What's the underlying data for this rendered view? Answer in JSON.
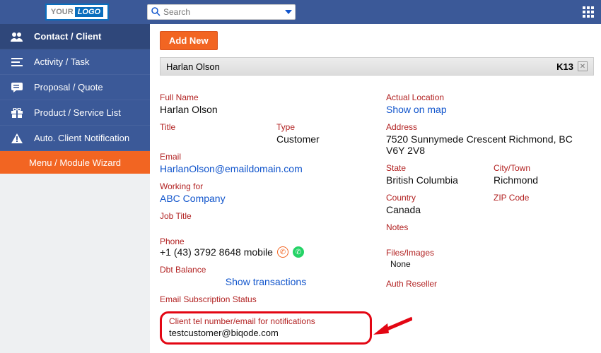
{
  "topbar": {
    "logo_your": "YOUR",
    "logo_logo": "LOGO",
    "search_placeholder": "Search"
  },
  "sidebar": {
    "items": [
      {
        "label": "Contact / Client"
      },
      {
        "label": "Activity / Task"
      },
      {
        "label": "Proposal / Quote"
      },
      {
        "label": "Product / Service List"
      },
      {
        "label": "Auto. Client Notification"
      }
    ],
    "wizard": "Menu / Module Wizard"
  },
  "main": {
    "add_new": "Add New",
    "record_name": "Harlan Olson",
    "record_code": "K13",
    "left": {
      "full_name_label": "Full Name",
      "full_name": "Harlan Olson",
      "title_label": "Title",
      "title": "",
      "type_label": "Type",
      "type": "Customer",
      "email_label": "Email",
      "email": "HarlanOlson@emaildomain.com",
      "working_for_label": "Working for",
      "working_for": "ABC Company",
      "job_title_label": "Job Title",
      "phone_label": "Phone",
      "phone": "+1 (43) 3792 8648 mobile",
      "dbt_label": "Dbt Balance",
      "show_txn": "Show transactions",
      "email_sub_label": "Email Subscription Status",
      "notif_label": "Client tel number/email for notifications",
      "notif_value": "testcustomer@biqode.com"
    },
    "right": {
      "actual_loc_label": "Actual Location",
      "show_on_map": "Show on map",
      "address_label": "Address",
      "address": "7520 Sunnymede Crescent Richmond, BC V6Y 2V8",
      "state_label": "State",
      "state": "British Columbia",
      "city_label": "City/Town",
      "city": "Richmond",
      "country_label": "Country",
      "country": "Canada",
      "zip_label": "ZIP Code",
      "notes_label": "Notes",
      "files_label": "Files/Images",
      "files": "None",
      "auth_label": "Auth Reseller"
    }
  }
}
